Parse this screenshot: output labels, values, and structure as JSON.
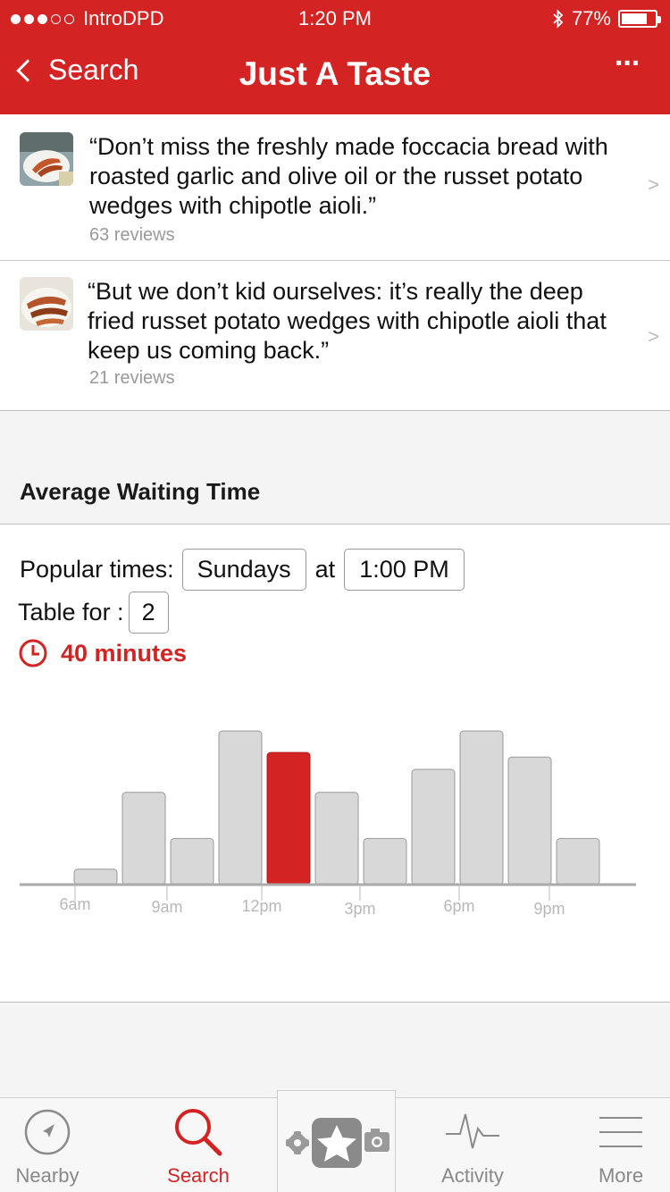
{
  "status_bar": {
    "carrier": "IntroDPD",
    "time": "1:20 PM",
    "battery": "77%",
    "battery_level": 0.77
  },
  "nav": {
    "back_label": "Search",
    "title": "Just A Taste",
    "more_label": "···"
  },
  "reviews": [
    {
      "quote": "“Don’t miss the freshly made foccacia bread with roasted garlic and olive oil or the russet potato wedges with chipotle aioli.”",
      "count": "63 reviews",
      "arrow": ">"
    },
    {
      "quote": "“But we don’t kid ourselves: it’s really the deep fried russet potato wedges with chipotle aioli that keep us coming back.”",
      "count": "21 reviews",
      "arrow": ">"
    }
  ],
  "waiting": {
    "section_title": "Average Waiting Time",
    "popular_label": "Popular times:",
    "day": "Sundays",
    "at_label": "at",
    "time": "1:00 PM",
    "table_label": "Table for :",
    "party_size": "2",
    "result": "40 minutes",
    "accent_color": "#d32323"
  },
  "chart_data": {
    "type": "bar",
    "categories": [
      "6am",
      "",
      "9am",
      "",
      "12pm",
      "",
      "3pm",
      "",
      "6pm",
      "",
      "9pm",
      ""
    ],
    "values": [
      1,
      6,
      3,
      10,
      8.6,
      6,
      3,
      7.5,
      10,
      8.3,
      3
    ],
    "highlight_index": 4,
    "highlight_color": "#d32323",
    "bar_color": "#d8d8d8",
    "tick_labels": [
      "6am",
      "9am",
      "12pm",
      "3pm",
      "6pm",
      "9pm"
    ]
  },
  "tabs": [
    {
      "label": "Nearby",
      "icon": "nearby-compass-icon",
      "active": false
    },
    {
      "label": "Search",
      "icon": "search-icon",
      "active": true
    },
    {
      "label": "",
      "icon": "check-in-star-icon",
      "active": false
    },
    {
      "label": "Activity",
      "icon": "activity-pulse-icon",
      "active": false
    },
    {
      "label": "More",
      "icon": "menu-lines-icon",
      "active": false
    }
  ]
}
